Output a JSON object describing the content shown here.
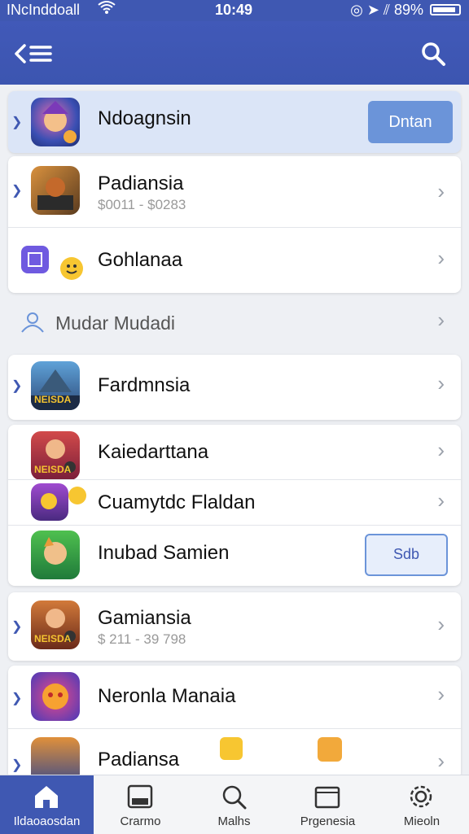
{
  "status_bar": {
    "carrier": "INcInddoall",
    "time": "10:49",
    "battery": "89%"
  },
  "nav": {
    "back_icon": "back-menu-icon",
    "search_icon": "search-icon"
  },
  "rows": [
    {
      "title": "Ndoagnsin",
      "button": "Dntan"
    },
    {
      "title": "Padiansia",
      "subtitle": "$0011 - $0283"
    },
    {
      "title": "Gohlanaa"
    },
    {
      "section": "Mudar Mudadi"
    },
    {
      "title": "Fardmnsia",
      "icon_caption": "NEISDA"
    },
    {
      "title": "Kaiedarttana",
      "icon_caption": "NEISDA"
    },
    {
      "title": "Cuamytdc Flaldan"
    },
    {
      "title": "Inubad Samien",
      "button": "Sdb"
    },
    {
      "title": "Gamiansia",
      "subtitle": "$ 211 - 39 798",
      "icon_caption": "NEISDA"
    },
    {
      "title": "Neronla Manaia"
    },
    {
      "title": "Padiansa"
    }
  ],
  "tabs": [
    {
      "label": "Ildaoaosdan",
      "icon": "home-icon",
      "active": true
    },
    {
      "label": "Crarmo",
      "icon": "media-icon",
      "active": false
    },
    {
      "label": "Malhs",
      "icon": "search-icon",
      "active": false
    },
    {
      "label": "Prgenesia",
      "icon": "folder-icon",
      "active": false
    },
    {
      "label": "Mieoln",
      "icon": "gear-icon",
      "active": false
    }
  ],
  "colors": {
    "accent": "#3f58b2",
    "button": "#6b94d9",
    "highlight": "#dbe5f7"
  }
}
